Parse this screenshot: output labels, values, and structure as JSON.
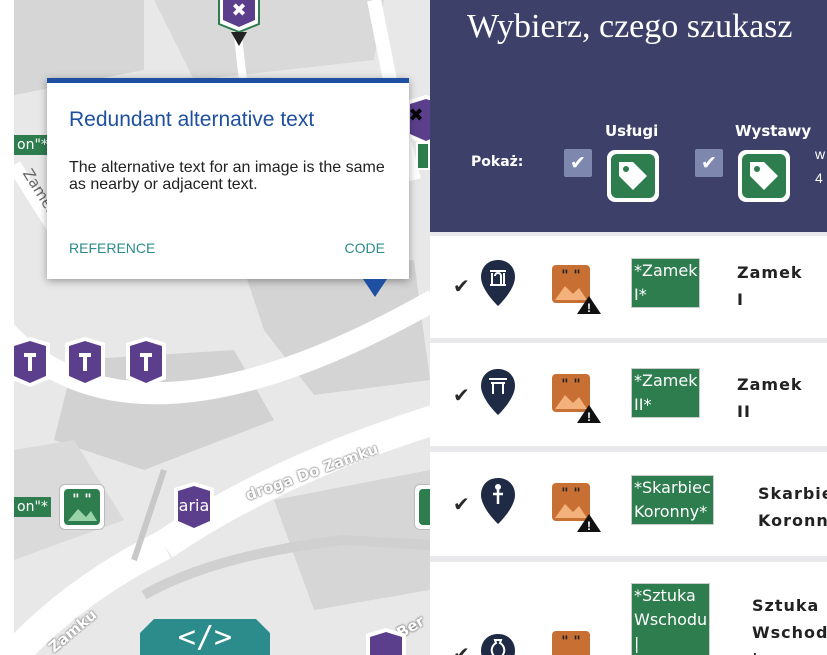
{
  "map": {
    "road_labels": {
      "droga_do_zamku": "droga Do Zamku",
      "zamek_ws": "Zamek Ws",
      "zamku": "Zamku",
      "ber": "Ber"
    },
    "edge_labels": {
      "top": "on\"*",
      "bottom": "on\"*"
    },
    "aria_badge": "aria",
    "close_badge": "✖",
    "code_button": "</>"
  },
  "tooltip": {
    "title": "Redundant alternative text",
    "description": "The alternative text for an image is the same as nearby or adjacent text.",
    "reference_label": "REFERENCE",
    "code_label": "CODE"
  },
  "panel": {
    "title": "Wybierz, czego szukasz",
    "show_label": "Pokaż:",
    "categories": [
      {
        "label": "Usługi",
        "checked_glyph": "✔"
      },
      {
        "label": "Wystawy",
        "checked_glyph": "✔"
      }
    ],
    "wystawy_extra": [
      "w",
      "4"
    ]
  },
  "rows": [
    {
      "check": "✔",
      "pin_icon": "gate-pin-icon",
      "alt_text": [
        "*Zamek",
        "I*"
      ],
      "name": [
        "Zamek",
        "I"
      ]
    },
    {
      "check": "✔",
      "pin_icon": "gate-pin-icon",
      "alt_text": [
        "*Zamek",
        "II*"
      ],
      "name": [
        "Zamek",
        "II"
      ]
    },
    {
      "check": "✔",
      "pin_icon": "figure-pin-icon",
      "alt_text": [
        "*Skarbiec",
        "Koronny*"
      ],
      "name": [
        "Skarbie",
        "Koronn"
      ]
    },
    {
      "check": "✔",
      "pin_icon": "vase-pin-icon",
      "alt_text": [
        "*Sztuka",
        "Wschodu",
        "|"
      ],
      "name": [
        "Sztuka",
        "Wschod",
        "|"
      ]
    }
  ]
}
